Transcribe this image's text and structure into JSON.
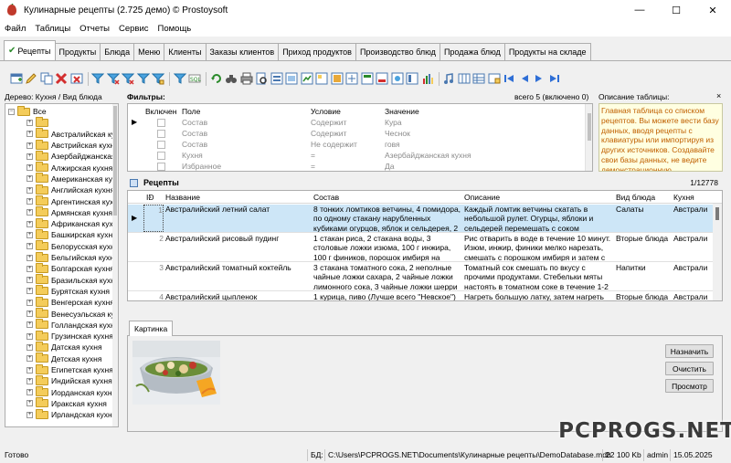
{
  "window": {
    "title": "Кулинарные рецепты (2.725 демо) © Prostoysoft",
    "minimize": "—",
    "maximize": "☐",
    "close": "✕"
  },
  "menu": [
    "Файл",
    "Таблицы",
    "Отчеты",
    "Сервис",
    "Помощь"
  ],
  "tabs": [
    {
      "label": "Рецепты",
      "active": true
    },
    {
      "label": "Продукты"
    },
    {
      "label": "Блюда"
    },
    {
      "label": "Меню"
    },
    {
      "label": "Клиенты"
    },
    {
      "label": "Заказы клиентов"
    },
    {
      "label": "Приход продуктов"
    },
    {
      "label": "Производство блюд"
    },
    {
      "label": "Продажа блюд"
    },
    {
      "label": "Продукты на складе"
    }
  ],
  "tree": {
    "label": "Дерево: Кухня / Вид блюда",
    "root": "Все",
    "items": [
      "",
      "Австралийская кухня",
      "Австрийская кухня",
      "Азербайджанская кухня",
      "Алжирская кухня",
      "Американская кухня",
      "Английская кухня",
      "Аргентинская кухня",
      "Армянская кухня",
      "Африканская кухня",
      "Башкирская кухня",
      "Белорусская кухня",
      "Бельгийская кухня",
      "Болгарская кухня",
      "Бразильская кухня",
      "Бурятская кухня",
      "Венгерская кухня",
      "Венесуэльская кухня",
      "Голландская кухня",
      "Грузинская кухня",
      "Датская кухня",
      "Детская кухня",
      "Египетская кухня",
      "Индийская кухня",
      "Иорданская кухня",
      "Иракская кухня",
      "Ирландская кухня"
    ]
  },
  "filters": {
    "title": "Фильтры:",
    "count": "всего 5 (включено 0)",
    "headers": {
      "enabled": "Включен",
      "field": "Поле",
      "condition": "Условие",
      "value": "Значение"
    },
    "rows": [
      {
        "field": "Состав",
        "condition": "Содержит",
        "value": "Кура"
      },
      {
        "field": "Состав",
        "condition": "Содержит",
        "value": "Чеснок"
      },
      {
        "field": "Состав",
        "condition": "Не содержит",
        "value": "говя"
      },
      {
        "field": "Кухня",
        "condition": "=",
        "value": "Азербайджанская кухня"
      },
      {
        "field": "Избранное",
        "condition": "=",
        "value": "Да"
      }
    ]
  },
  "description": {
    "title": "Описание таблицы:",
    "close": "×",
    "text": "Главная таблица со списком рецептов. Вы можете вести базу данных, вводя рецепты с клавиатуры или импортируя из других источников. Создавайте свои базы данных, не ведите демонстрационную"
  },
  "recipes": {
    "title": "Рецепты",
    "count": "1/12778",
    "headers": {
      "id": "ID",
      "sort": "▲",
      "name": "Название",
      "composition": "Состав",
      "description": "Описание",
      "dish_type": "Вид блюда",
      "cuisine": "Кухня"
    },
    "rows": [
      {
        "id": "1",
        "name": "Австралийский летний салат",
        "composition": "8 тонких ломтиков ветчины, 4 помидора, по одному стакану нарубленных кубиками огурцов, яблок и сельдерея, 2",
        "description": "Каждый ломтик ветчины скатать в небольшой рулет. Огурцы, яблоки и сельдерей перемешать с соком",
        "dish_type": "Салаты",
        "cuisine": "Австрали"
      },
      {
        "id": "2",
        "name": "Австралийский рисовый пудинг",
        "composition": "1 стакан риса, 2 стакана воды, 3 столовые ложки изюма, 100 г инжира, 100 г фиников, порошок имбиря на",
        "description": "Рис отварить в воде в течение 10 минут. Изюм, инжир, финики мелко нарезать, смешать с порошком имбиря и затем с",
        "dish_type": "Вторые блюда",
        "cuisine": "Австрали"
      },
      {
        "id": "3",
        "name": "Австралийский томатный коктейль",
        "composition": "3 стакана томатного сока, 2 неполные чайные ложки сахара, 2 чайные ложки лимонного сока, 3 чайные ложки шерри",
        "description": "Томатный сок смешать по вкусу с прочими продуктами. Стебельки мяты настоять в томатном соке в течение 1-2",
        "dish_type": "Напитки",
        "cuisine": "Австрали"
      },
      {
        "id": "4",
        "name": "Австралийский цыпленок",
        "composition": "1 курица, пиво (Лучше всего \"Невское\")",
        "description": "Нагреть большую латку, затем нагреть",
        "dish_type": "Вторые блюда",
        "cuisine": "Австрали"
      }
    ]
  },
  "picture": {
    "tab": "Картинка",
    "assign": "Назначить",
    "clear": "Очистить",
    "view": "Просмотр"
  },
  "status": {
    "state": "Готово",
    "db_label": "БД:",
    "db_path": "C:\\Users\\PCPROGS.NET\\Documents\\Кулинарные рецепты\\DemoDatabase.mdb",
    "size": "22 100 Kb",
    "user": "admin",
    "date": "15.05.2025"
  },
  "watermark": "PCPROGS.NET"
}
